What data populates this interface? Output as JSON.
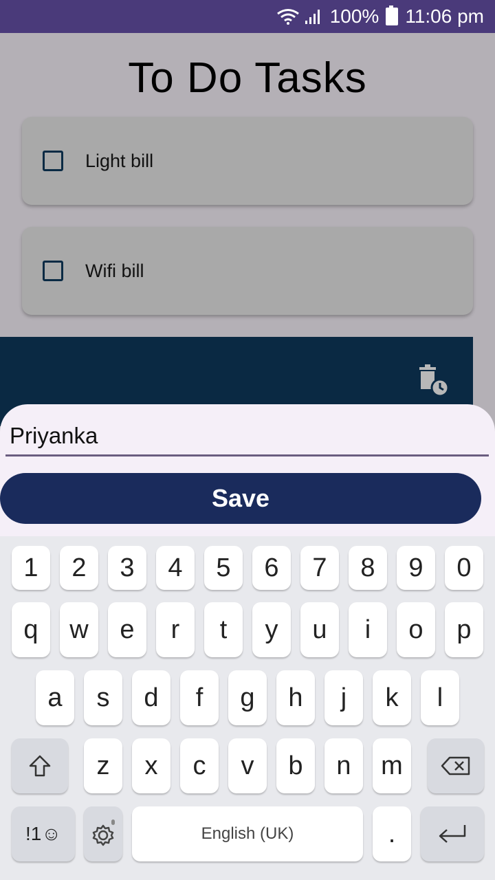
{
  "status_bar": {
    "battery": "100%",
    "time": "11:06 pm"
  },
  "page_title": "To Do Tasks",
  "tasks": [
    {
      "label": "Light bill",
      "checked": false
    },
    {
      "label": "Wifi bill",
      "checked": false
    }
  ],
  "panel": {
    "icon": "delete-scheduled-icon"
  },
  "edit_sheet": {
    "input_value": "Priyanka",
    "save_label": "Save"
  },
  "keyboard": {
    "row_numbers": [
      "1",
      "2",
      "3",
      "4",
      "5",
      "6",
      "7",
      "8",
      "9",
      "0"
    ],
    "row_1": [
      "q",
      "w",
      "e",
      "r",
      "t",
      "y",
      "u",
      "i",
      "o",
      "p"
    ],
    "row_2": [
      "a",
      "s",
      "d",
      "f",
      "g",
      "h",
      "j",
      "k",
      "l"
    ],
    "row_3": [
      "z",
      "x",
      "c",
      "v",
      "b",
      "n",
      "m"
    ],
    "symbols_label": "!1☺",
    "space_label": "English (UK)",
    "period": "."
  },
  "colors": {
    "status_bar": "#4a3a7a",
    "panel": "#0a2943",
    "save_button": "#1a2b5c",
    "sheet": "#f5eff8"
  }
}
